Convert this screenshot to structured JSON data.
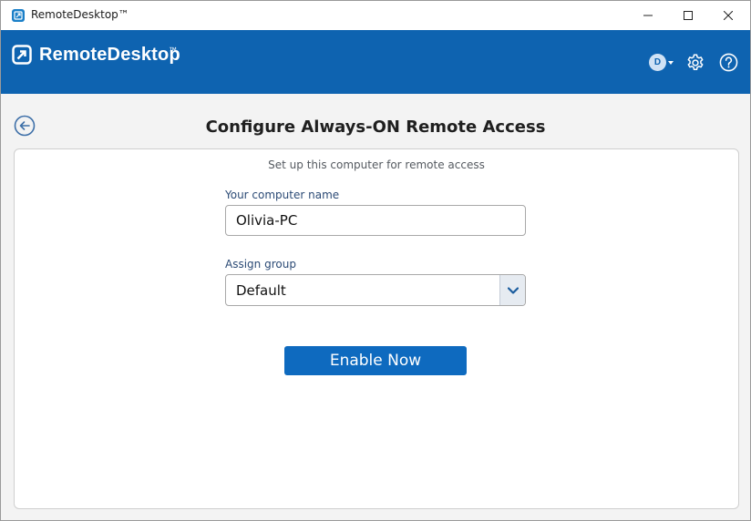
{
  "window": {
    "title": "RemoteDesktop™"
  },
  "header": {
    "logo_text": "RemoteDesktop",
    "logo_tm": "™",
    "avatar_initial": "D"
  },
  "page": {
    "title": "Configure Always-ON Remote Access",
    "subtitle": "Set up this computer for remote access"
  },
  "form": {
    "computer_name_label": "Your computer name",
    "computer_name_value": "Olivia-PC",
    "group_label": "Assign group",
    "group_selected": "Default",
    "submit_label": "Enable Now"
  },
  "colors": {
    "brand": "#0e63b0",
    "button": "#0e6abf",
    "label": "#2b4a75"
  },
  "icons": {
    "app": "remotedesktop-app-icon",
    "logo": "remotedesktop-logo-icon",
    "minimize": "minimize-icon",
    "maximize": "maximize-icon",
    "close": "close-icon",
    "caret": "caret-down-icon",
    "settings": "gear-icon",
    "help": "help-icon",
    "back": "back-arrow-icon",
    "dropdown": "chevron-down-icon"
  }
}
